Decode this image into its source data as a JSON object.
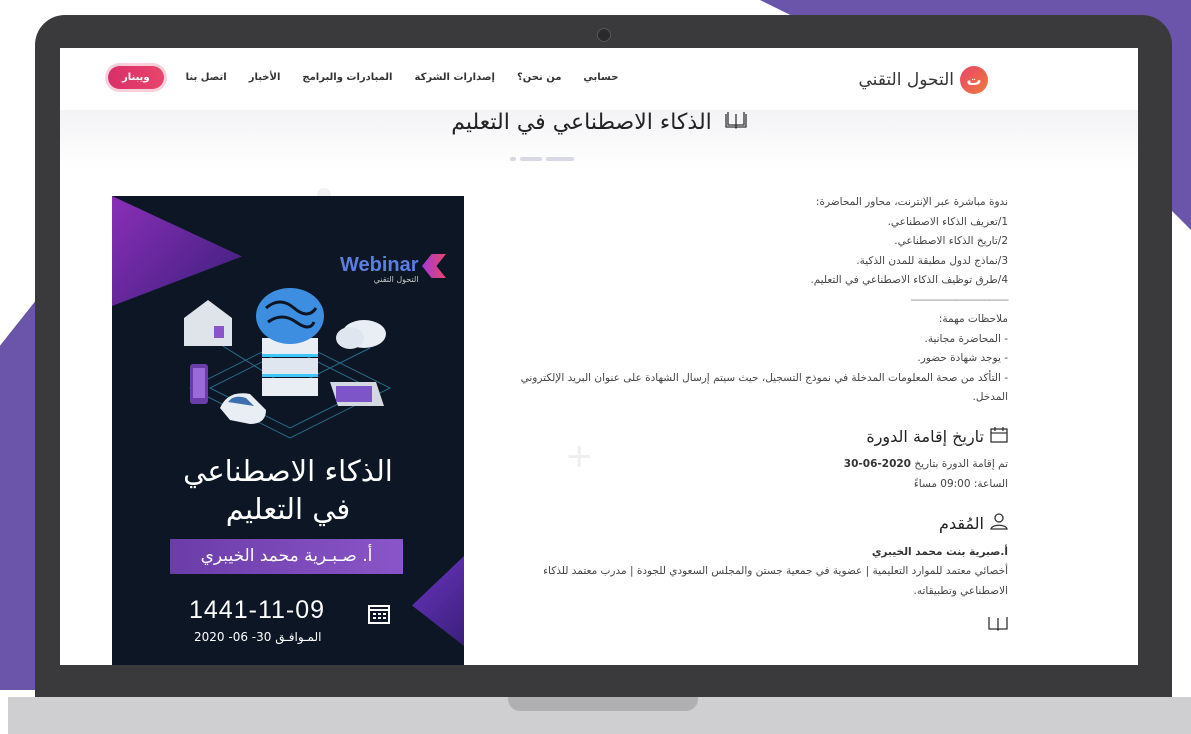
{
  "nav": {
    "logo_text": "التحول التقني",
    "logo_mark": "ت",
    "links": [
      "حسابي",
      "من نحن؟",
      "إصدارات الشركة",
      "المبادرات والبرامج",
      "الأخبار",
      "اتصل بنا"
    ],
    "cta": "ويبنار"
  },
  "page": {
    "title": "الذكاء الاصطناعي في التعليم"
  },
  "description": {
    "lines": [
      "ندوة مباشرة عبر الإنترنت، محاور المحاضرة:",
      "1/تعريف الذكاء الاصطناعي.",
      "2/تاريخ الذكاء الاصطناعي.",
      "3/نماذج لدول مطبقة للمدن الذكية.",
      "4/طرق توظيف الذكاء الاصطناعي في التعليم."
    ],
    "divider": "-----------------------------------"
  },
  "notes": {
    "heading": "ملاحظات مهمة:",
    "items": [
      "- المحاضرة مجانية.",
      "- يوجد شهادة حضور.",
      "- التأكد من صحة المعلومات المدخلة في نموذج التسجيل، حيث سيتم إرسال الشهادة على عنوان البريد الإلكتروني المدخل."
    ]
  },
  "schedule": {
    "heading": "تاريخ إقامة الدورة",
    "date_prefix": "تم إقامة الدورة بتاريخ",
    "date_value": "2020-06-30",
    "time_line": "الساعة: 09:00 مساءً"
  },
  "presenter": {
    "heading": "المُقدم",
    "name": "أ.صبرية بنت محمد الخيبري",
    "bio": "أخصائي معتمد للموارد التعليمية | عضوية في جمعية جستن والمجلس السعودي للجودة | مدرب معتمد للذكاء الاصطناعي وتطبيقاته."
  },
  "poster": {
    "badge_word": "Webinar",
    "badge_sub": "التحول التقني",
    "title_line1": "الذكاء الاصطناعي",
    "title_line2": "في التعليم",
    "presenter": "أ. صـبـرية محمد الخيبري",
    "hijri_date": "1441-11-09",
    "gregorian_date": "المـوافـق 30- 06- 2020"
  },
  "icons": {
    "title": "book-icon",
    "schedule": "calendar-icon",
    "presenter": "user-icon",
    "next_section": "book-icon"
  },
  "colors": {
    "brand_purple": "#6a55aa",
    "cta_pink": "#e8456b",
    "poster_bg": "#0c1624"
  }
}
